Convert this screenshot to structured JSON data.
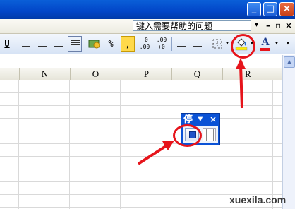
{
  "window": {
    "minimize": "_",
    "maximize": "□",
    "close": "×"
  },
  "menubar": {
    "help_box_text": "键入需要帮助的问题",
    "help_dropdown": "▾",
    "mdi_min": "–",
    "mdi_restore": "▫",
    "mdi_close": "×"
  },
  "toolbar": {
    "underline": "U",
    "currency": "🪙",
    "percent": "%",
    "comma": ",",
    "increase_decimal": "←0\n.00",
    "increase_decimal_label": "+0",
    "decrease_decimal_label": ".00",
    "fill_color_dropdown": "▾",
    "font_color": "A",
    "font_color_dropdown": "▾",
    "colors": {
      "font_color_bar": "#e6141b",
      "fill_color_bar": "#ffee00"
    }
  },
  "sheet": {
    "columns": [
      "N",
      "O",
      "P",
      "Q",
      "R"
    ]
  },
  "stop_toolbar": {
    "title": "停",
    "menu_arrow": "▼",
    "close": "×"
  },
  "annotations": {
    "color": "#e6141b"
  },
  "watermark": "xuexila.com"
}
